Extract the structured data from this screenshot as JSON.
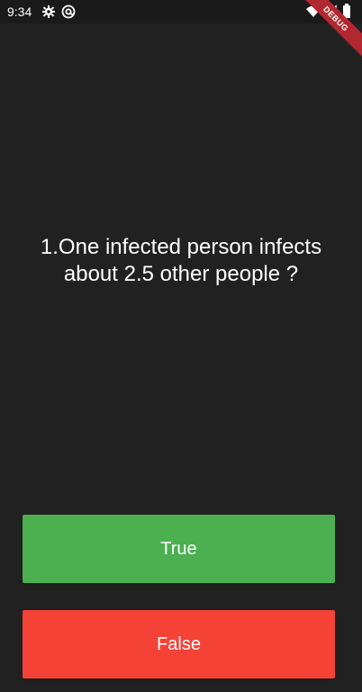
{
  "status_bar": {
    "time": "9:34",
    "icons": [
      "gear-icon",
      "at-sign-icon",
      "wifi-icon",
      "signal-icon",
      "battery-icon"
    ]
  },
  "debug_banner": {
    "label": "DEBUG"
  },
  "quiz": {
    "question": "1.One infected person infects about 2.5 other people ?",
    "true_label": "True",
    "false_label": "False"
  },
  "colors": {
    "background": "#212121",
    "true_button": "#4caf50",
    "false_button": "#f44336",
    "debug_banner": "#b22830"
  }
}
